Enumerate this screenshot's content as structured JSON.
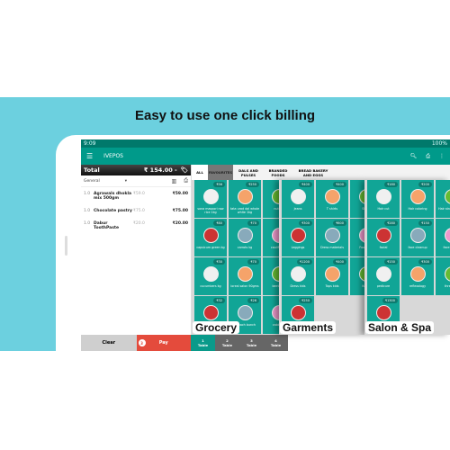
{
  "headline": "Easy to use one click billing",
  "status": {
    "time": "9:09",
    "battery": "100%"
  },
  "appbar": {
    "title": "IVEPOS"
  },
  "order": {
    "total_label": "Total",
    "total": "₹ 154.00 -",
    "category": "General",
    "items": [
      {
        "qty": "1.0",
        "name": "Agrawals dhokla mix 500gm",
        "unit": "₹59.0",
        "total": "₹59.00"
      },
      {
        "qty": "1.0",
        "name": "Chocolate pastry",
        "unit": "₹75.0",
        "total": "₹75.00"
      },
      {
        "qty": "1.0",
        "name": "Dabur ToothPaste",
        "unit": "₹20.0",
        "total": "₹20.00"
      }
    ]
  },
  "tabs": [
    "ALL",
    "FAVOURITES",
    "DALS AND PULSES",
    "BRANDED FOODS",
    "BREAD BAKERY AND EGGS"
  ],
  "bottom": {
    "clear": "Clear",
    "pay": "Pay",
    "pay_count": "3",
    "tables": [
      {
        "num": "1",
        "label": "Table"
      },
      {
        "num": "2",
        "label": "Table"
      },
      {
        "num": "3",
        "label": "Table"
      },
      {
        "num": "4",
        "label": "Table"
      }
    ]
  },
  "panels": [
    {
      "name": "Grocery",
      "items": [
        {
          "price": "₹56",
          "label": "sona masoori raw rice 1kg"
        },
        {
          "price": "₹250",
          "label": "tata urad dal whole white 1kg"
        },
        {
          "price": "",
          "label": "nutella"
        },
        {
          "price": "₹80",
          "label": "capsicum green kg"
        },
        {
          "price": "₹70",
          "label": "carrots kg"
        },
        {
          "price": "",
          "label": "cauliflower"
        },
        {
          "price": "₹30",
          "label": "cucumbers kg"
        },
        {
          "price": "₹70",
          "label": "loreal salon 90gms"
        },
        {
          "price": "",
          "label": "beet root"
        },
        {
          "price": "₹32",
          "label": ""
        },
        {
          "price": "₹26",
          "label": "spinach bunch"
        },
        {
          "price": "",
          "label": "cabbage"
        }
      ]
    },
    {
      "name": "Garments",
      "items": [
        {
          "price": "₹400",
          "label": "Jeans"
        },
        {
          "price": "₹400",
          "label": "T shirts"
        },
        {
          "price": "",
          "label": "Shirts"
        },
        {
          "price": "₹300",
          "label": "Leggings"
        },
        {
          "price": "₹600",
          "label": "Dress materials"
        },
        {
          "price": "",
          "label": "Footwear"
        },
        {
          "price": "₹1200",
          "label": "Dress kids"
        },
        {
          "price": "₹400",
          "label": "Tops kids"
        },
        {
          "price": "",
          "label": "Kurtis"
        },
        {
          "price": "₹250",
          "label": ""
        }
      ]
    },
    {
      "name": "Salon & Spa",
      "items": [
        {
          "price": "₹180",
          "label": "Hair cut"
        },
        {
          "price": "₹200",
          "label": "Hair coloring"
        },
        {
          "price": "",
          "label": "Hair straightening"
        },
        {
          "price": "₹280",
          "label": "facial"
        },
        {
          "price": "₹150",
          "label": "face cleanup"
        },
        {
          "price": "",
          "label": "face bleach"
        },
        {
          "price": "₹150",
          "label": "pedicure"
        },
        {
          "price": "₹300",
          "label": "reflexology"
        },
        {
          "price": "",
          "label": "threading"
        },
        {
          "price": "₹1500",
          "label": ""
        }
      ]
    }
  ],
  "colors": {
    "teal": "#009a8a",
    "band": "#6cd0df",
    "pay": "#e44b3c"
  }
}
